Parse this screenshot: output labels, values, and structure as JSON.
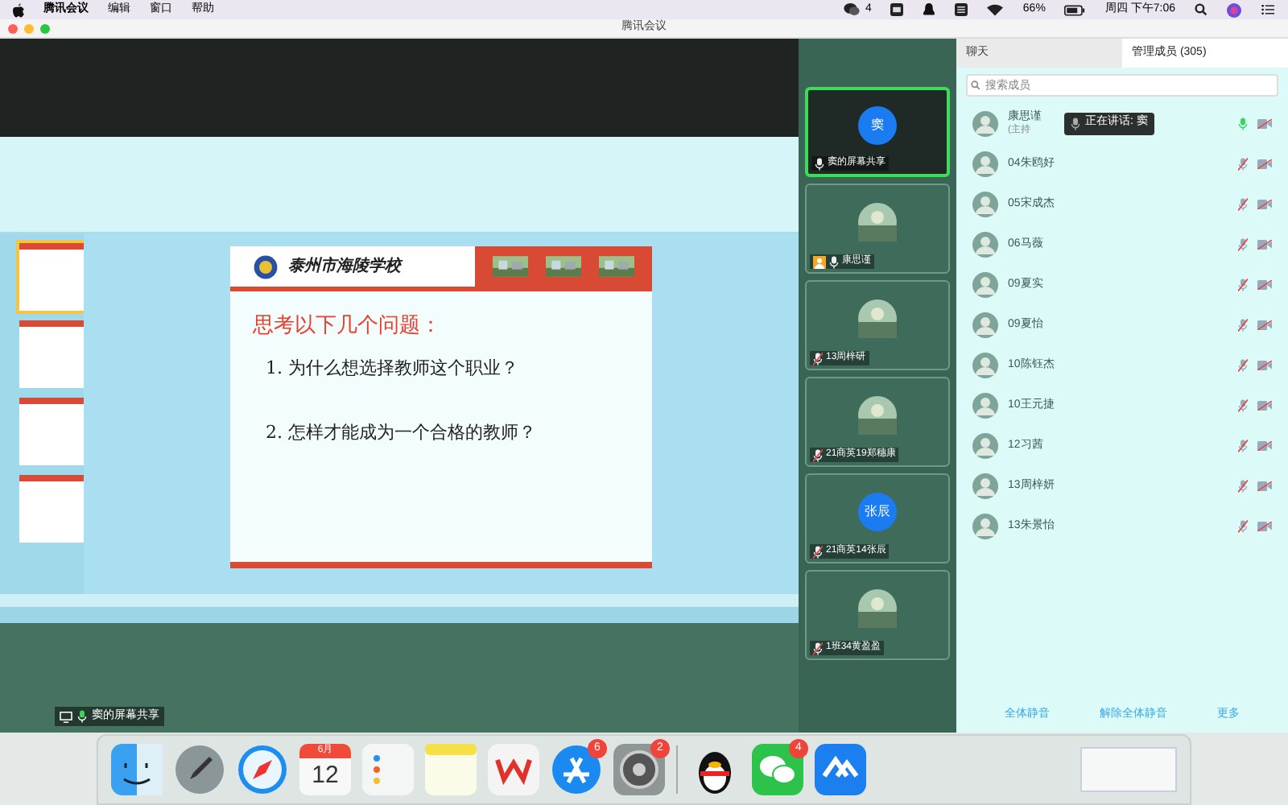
{
  "menu_bar": {
    "app": "腾讯会议",
    "menus": [
      "编辑",
      "窗口",
      "帮助"
    ],
    "wechat_count": "4",
    "battery": "66%",
    "clock": "周四 下午7:06"
  },
  "window": {
    "title": "腾讯会议"
  },
  "shared_screen": {
    "label": "窦的屏幕共享",
    "slide": {
      "school": "泰州市海陵学校",
      "heading": "思考以下几个问题：",
      "questions": [
        "1. 为什么想选择教师这个职业？",
        "2. 怎样才能成为一个合格的教师？"
      ]
    }
  },
  "video_tiles": [
    {
      "name": "窦的屏幕共享",
      "kind": "initials",
      "avatar": "窦",
      "muted": false,
      "selected": true,
      "host": false
    },
    {
      "name": "康思谨",
      "muted": false,
      "selected": false,
      "host": true
    },
    {
      "name": "13周梓研",
      "muted": true,
      "selected": false,
      "host": false
    },
    {
      "name": "21商英19郑穗康",
      "muted": true,
      "selected": false,
      "host": false
    },
    {
      "name": "21商英14张辰",
      "kind": "initials",
      "avatar": "张辰",
      "muted": true,
      "selected": false,
      "host": false
    },
    {
      "name": "1班34黄盈盈",
      "muted": true,
      "selected": false,
      "host": false
    }
  ],
  "panel": {
    "tabs": [
      {
        "label": "聊天",
        "selected": false
      },
      {
        "label": "管理成员 (305)",
        "selected": true
      }
    ],
    "search_placeholder": "搜索成员",
    "speaking": "正在讲话: 窦",
    "members": [
      {
        "name": "康思谨",
        "role": "(主持",
        "muted": false
      },
      {
        "name": "04朱鸥好",
        "muted": true
      },
      {
        "name": "05宋成杰",
        "muted": true
      },
      {
        "name": "06马薇",
        "muted": true
      },
      {
        "name": "09夏实",
        "muted": true
      },
      {
        "name": "09夏怡",
        "muted": true
      },
      {
        "name": "10陈钰杰",
        "muted": true
      },
      {
        "name": "10王元捷",
        "muted": true
      },
      {
        "name": "12习茜",
        "muted": true
      },
      {
        "name": "13周梓妍",
        "muted": true
      },
      {
        "name": "13朱景怡",
        "muted": true
      }
    ],
    "actions": [
      "全体静音",
      "解除全体静音",
      "更多"
    ]
  },
  "dock": [
    {
      "kind": "finder"
    },
    {
      "kind": "launchpad"
    },
    {
      "kind": "safari"
    },
    {
      "kind": "calendar",
      "month": "6月",
      "day": "12"
    },
    {
      "kind": "reminders"
    },
    {
      "kind": "notes"
    },
    {
      "kind": "wps"
    },
    {
      "kind": "appstore",
      "badge": "6"
    },
    {
      "kind": "settings",
      "badge": "2"
    },
    {
      "kind": "qq"
    },
    {
      "kind": "wechat",
      "badge": "4"
    },
    {
      "kind": "meeting"
    }
  ]
}
